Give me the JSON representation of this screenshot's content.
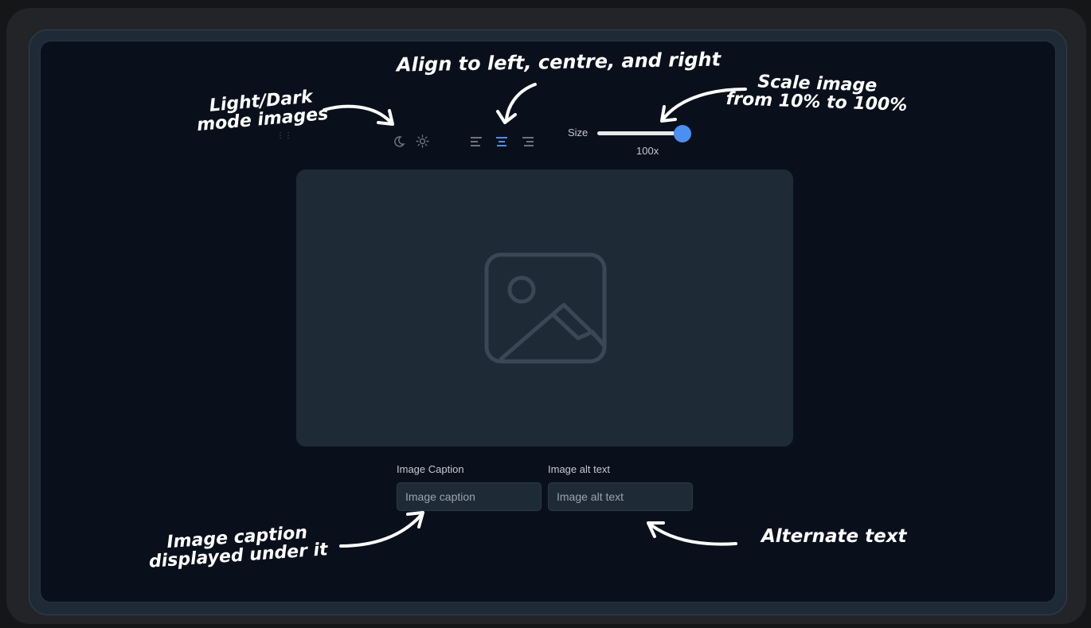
{
  "annotations": {
    "light_dark": [
      "Light/Dark",
      "mode images"
    ],
    "align": "Align to left, centre, and right",
    "scale": [
      "Scale image",
      "from 10% to 100%"
    ],
    "caption": [
      "Image caption",
      "displayed under it"
    ],
    "alt": "Alternate text"
  },
  "toolbar": {
    "theme_icons": [
      "moon-icon",
      "sun-icon"
    ],
    "align_icons": [
      "align-left-icon",
      "align-center-icon",
      "align-right-icon"
    ],
    "active_align": "center",
    "size_label": "Size",
    "size_value": "100x",
    "size_fraction": 1.0
  },
  "image": {
    "placeholder_icon": "image-icon"
  },
  "fields": {
    "caption_label": "Image Caption",
    "caption_placeholder": "Image caption",
    "alt_label": "Image alt text",
    "alt_placeholder": "Image alt text"
  },
  "colors": {
    "accent": "#4a8ff2",
    "background": "#0a101b",
    "panel": "#1f2a37"
  }
}
